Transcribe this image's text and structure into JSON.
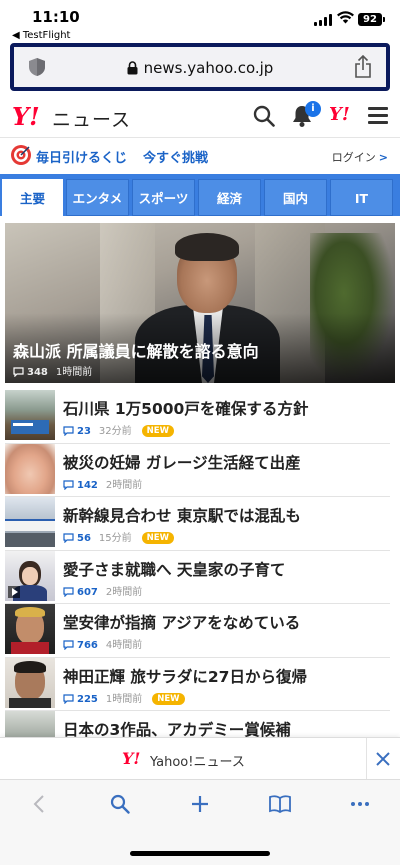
{
  "status": {
    "time": "11:10",
    "back_app": "◀ TestFlight",
    "battery": "92"
  },
  "address": {
    "url": "news.yahoo.co.jp"
  },
  "header": {
    "logo_mark": "Y!",
    "logo_text": "ニュース",
    "notification_count": "i",
    "yahoo_mark": "Y!"
  },
  "promo": {
    "lottery": "毎日引けるくじ",
    "challenge": "今すぐ挑戦",
    "login": "ログイン"
  },
  "tabs": [
    {
      "label": "主要"
    },
    {
      "label": "エンタメ"
    },
    {
      "label": "スポーツ"
    },
    {
      "label": "経済"
    },
    {
      "label": "国内"
    },
    {
      "label": "IT"
    }
  ],
  "hero": {
    "title": "森山派 所属議員に解散を諮る意向",
    "comments": "348",
    "time": "1時間前"
  },
  "articles": [
    {
      "title": "石川県 1万5000戸を確保する方針",
      "comments": "23",
      "time": "32分前",
      "badge": "NEW"
    },
    {
      "title": "被災の妊婦 ガレージ生活経て出産",
      "comments": "142",
      "time": "2時間前"
    },
    {
      "title": "新幹線見合わせ 東京駅では混乱も",
      "comments": "56",
      "time": "15分前",
      "badge": "NEW"
    },
    {
      "title": "愛子さま就職へ 天皇家の子育て",
      "comments": "607",
      "time": "2時間前"
    },
    {
      "title": "堂安律が指摘 アジアをなめている",
      "comments": "766",
      "time": "4時間前"
    },
    {
      "title": "神田正輝 旅サラダに27日から復帰",
      "comments": "225",
      "time": "1時間前",
      "badge": "NEW"
    },
    {
      "title": "日本の3作品、アカデミー賞候補"
    }
  ],
  "banner": {
    "mark": "Y!",
    "text": "Yahoo!ニュース"
  },
  "colors": {
    "accent": "#1a63c7",
    "brand_red": "#ff0033",
    "tab_bar": "#3a7ee0",
    "new_badge": "#f5b400"
  }
}
